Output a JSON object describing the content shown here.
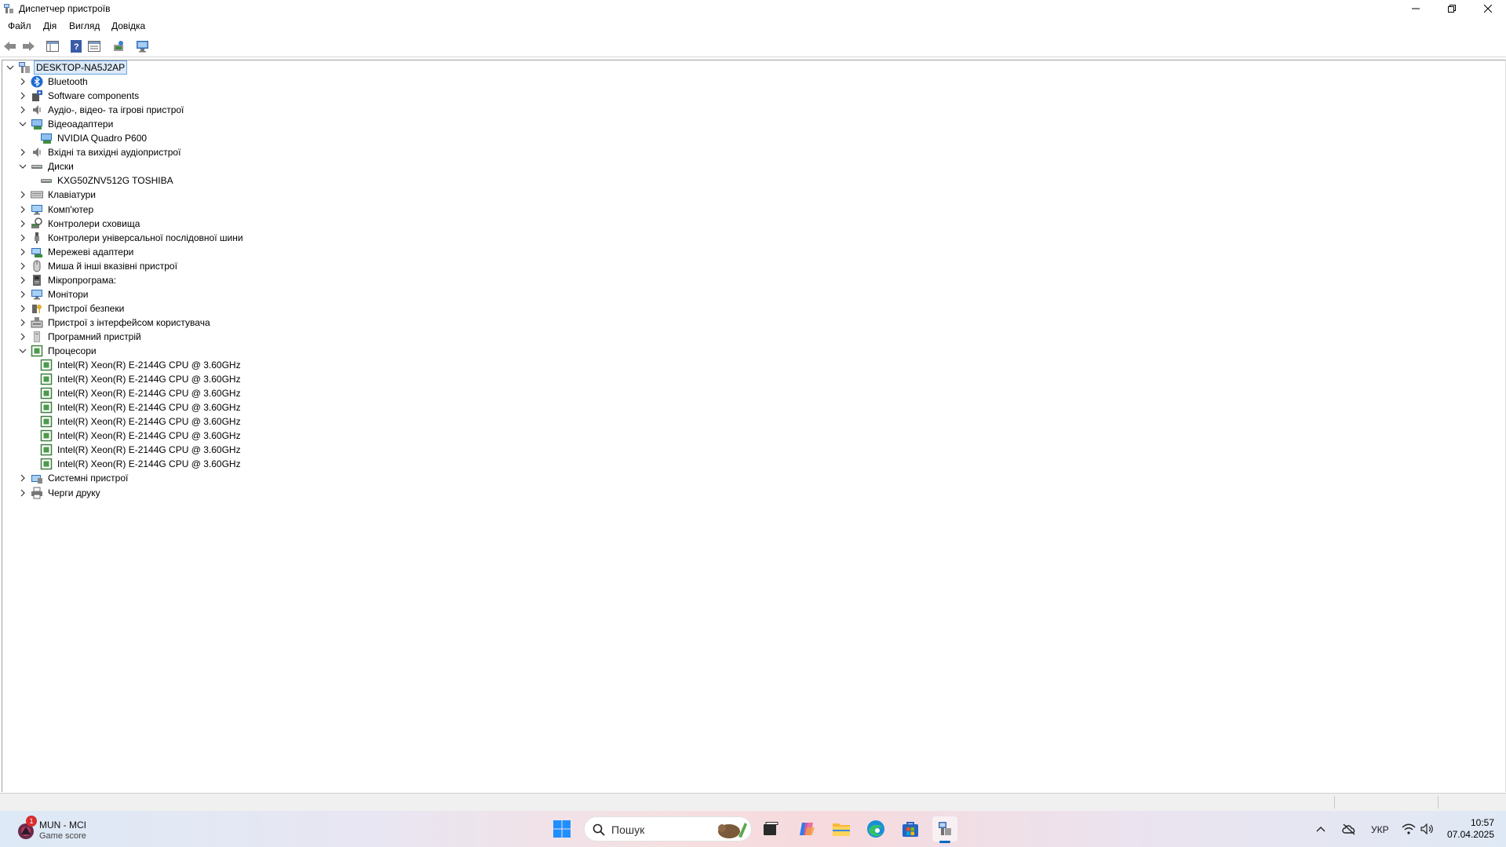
{
  "window": {
    "title": "Диспетчер пристроїв"
  },
  "menu": [
    "Файл",
    "Дія",
    "Вигляд",
    "Довідка"
  ],
  "tree": {
    "root": "DESKTOP-NA5J2AP",
    "items": [
      {
        "label": "Bluetooth",
        "icon": "bluetooth-icon",
        "level": 1,
        "expanded": false
      },
      {
        "label": "Software components",
        "icon": "puzzle-icon",
        "level": 1,
        "expanded": false
      },
      {
        "label": "Аудіо-, відео- та ігрові пристрої",
        "icon": "speaker-icon",
        "level": 1,
        "expanded": false
      },
      {
        "label": "Відеоадаптери",
        "icon": "display-adapter-icon",
        "level": 1,
        "expanded": true
      },
      {
        "label": "NVIDIA Quadro P600",
        "icon": "display-adapter-icon",
        "level": 2
      },
      {
        "label": "Вхідні та вихідні аудіопристрої",
        "icon": "speaker-icon",
        "level": 1,
        "expanded": false
      },
      {
        "label": "Диски",
        "icon": "disk-icon",
        "level": 1,
        "expanded": true
      },
      {
        "label": "KXG50ZNV512G TOSHIBA",
        "icon": "disk-icon",
        "level": 2
      },
      {
        "label": "Клавіатури",
        "icon": "keyboard-icon",
        "level": 1,
        "expanded": false
      },
      {
        "label": "Комп'ютер",
        "icon": "monitor-icon",
        "level": 1,
        "expanded": false
      },
      {
        "label": "Контролери сховища",
        "icon": "storage-controller-icon",
        "level": 1,
        "expanded": false
      },
      {
        "label": "Контролери універсальної послідовної шини",
        "icon": "usb-icon",
        "level": 1,
        "expanded": false
      },
      {
        "label": "Мережеві адаптери",
        "icon": "network-icon",
        "level": 1,
        "expanded": false
      },
      {
        "label": "Миша й інші вказівні пристрої",
        "icon": "mouse-icon",
        "level": 1,
        "expanded": false
      },
      {
        "label": "Мікропрограма:",
        "icon": "firmware-icon",
        "level": 1,
        "expanded": false
      },
      {
        "label": "Монітори",
        "icon": "monitor-icon",
        "level": 1,
        "expanded": false
      },
      {
        "label": "Пристрої безпеки",
        "icon": "security-key-icon",
        "level": 1,
        "expanded": false
      },
      {
        "label": "Пристрої з інтерфейсом користувача",
        "icon": "hid-icon",
        "level": 1,
        "expanded": false
      },
      {
        "label": "Програмний пристрій",
        "icon": "software-device-icon",
        "level": 1,
        "expanded": false
      },
      {
        "label": "Процесори",
        "icon": "cpu-icon",
        "level": 1,
        "expanded": true
      },
      {
        "label": "Intel(R) Xeon(R) E-2144G CPU @ 3.60GHz",
        "icon": "cpu-icon",
        "level": 2
      },
      {
        "label": "Intel(R) Xeon(R) E-2144G CPU @ 3.60GHz",
        "icon": "cpu-icon",
        "level": 2
      },
      {
        "label": "Intel(R) Xeon(R) E-2144G CPU @ 3.60GHz",
        "icon": "cpu-icon",
        "level": 2
      },
      {
        "label": "Intel(R) Xeon(R) E-2144G CPU @ 3.60GHz",
        "icon": "cpu-icon",
        "level": 2
      },
      {
        "label": "Intel(R) Xeon(R) E-2144G CPU @ 3.60GHz",
        "icon": "cpu-icon",
        "level": 2
      },
      {
        "label": "Intel(R) Xeon(R) E-2144G CPU @ 3.60GHz",
        "icon": "cpu-icon",
        "level": 2
      },
      {
        "label": "Intel(R) Xeon(R) E-2144G CPU @ 3.60GHz",
        "icon": "cpu-icon",
        "level": 2
      },
      {
        "label": "Intel(R) Xeon(R) E-2144G CPU @ 3.60GHz",
        "icon": "cpu-icon",
        "level": 2
      },
      {
        "label": "Системні пристрої",
        "icon": "system-devices-icon",
        "level": 1,
        "expanded": false
      },
      {
        "label": "Черги друку",
        "icon": "printer-icon",
        "level": 1,
        "expanded": false
      }
    ]
  },
  "taskbar": {
    "widget": {
      "title": "MUN - MCI",
      "subtitle": "Game score",
      "badge": "1"
    },
    "search_placeholder": "Пошук",
    "language": "УКР",
    "time": "10:57",
    "date": "07.04.2025"
  },
  "colors": {
    "selection": "#dbe9f7",
    "accent": "#0067c0",
    "windows_blue": "#1f8fff"
  }
}
